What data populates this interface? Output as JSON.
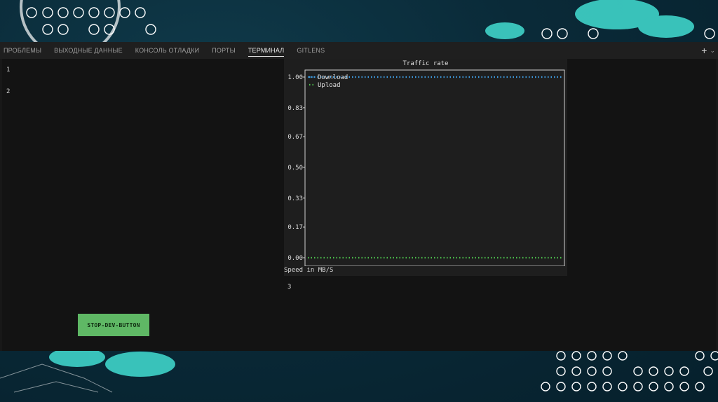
{
  "tabs": [
    {
      "label": "ПРОБЛЕМЫ"
    },
    {
      "label": "ВЫХОДНЫЕ ДАННЫЕ"
    },
    {
      "label": "КОНСОЛЬ ОТЛАДКИ"
    },
    {
      "label": "ПОРТЫ"
    },
    {
      "label": "ТЕРМИНАЛ",
      "active": true
    },
    {
      "label": "GITLENS"
    }
  ],
  "actions": {
    "add": "+",
    "dropdown": "⌄"
  },
  "terminal": {
    "line1": "1",
    "line2": "2",
    "line3": "3",
    "stop_button": "STOP-DEV-BUTTON",
    "speed_label": "Speed in MB/S"
  },
  "chart_data": {
    "type": "line",
    "title": "Traffic rate",
    "yticks": [
      "0.00",
      "0.17",
      "0.33",
      "0.50",
      "0.67",
      "0.83",
      "1.00"
    ],
    "ylim": [
      0,
      1
    ],
    "legend_position": "top-left",
    "series": [
      {
        "name": "Download",
        "color": "#3f9fe6",
        "values": [
          1.0,
          1.0
        ]
      },
      {
        "name": "Upload",
        "color": "#4cc14c",
        "values": [
          0.0,
          0.0
        ]
      }
    ]
  }
}
